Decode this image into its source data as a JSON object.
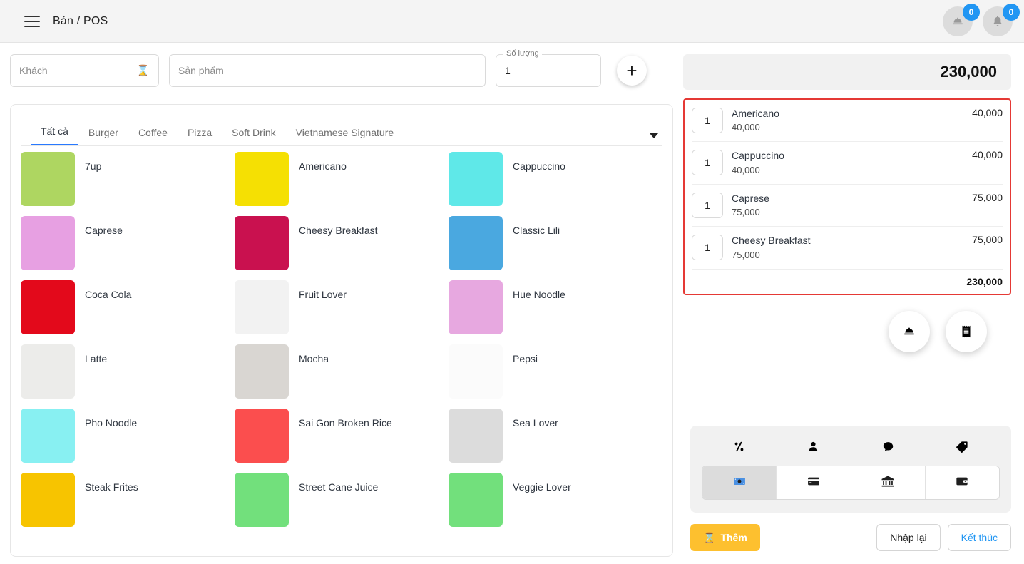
{
  "appbar": {
    "menu_icon": "hamburger-icon",
    "title": "Bán / POS",
    "service_badge": "0",
    "notification_badge": "0"
  },
  "search_row": {
    "customer": {
      "placeholder": "Khách",
      "value": "",
      "trail_icon": "hourglass-icon"
    },
    "product": {
      "placeholder": "Sản phẩm",
      "value": ""
    },
    "quantity": {
      "label": "Số lượng",
      "value": "1"
    },
    "add_button_icon": "plus-icon"
  },
  "tabs": [
    {
      "label": "Tất cả",
      "active": true
    },
    {
      "label": "Burger",
      "active": false
    },
    {
      "label": "Coffee",
      "active": false
    },
    {
      "label": "Pizza",
      "active": false
    },
    {
      "label": "Soft Drink",
      "active": false
    },
    {
      "label": "Vietnamese Signature",
      "active": false
    }
  ],
  "products": [
    {
      "name": "7up",
      "bg": "#aed661"
    },
    {
      "name": "Americano",
      "bg": "#f5e003"
    },
    {
      "name": "Cappuccino",
      "bg": "#5fe8e8"
    },
    {
      "name": "Caprese",
      "bg": "#e7a0e2"
    },
    {
      "name": "Cheesy Breakfast",
      "bg": "#c9114f"
    },
    {
      "name": "Classic Lili",
      "bg": "#4aa8e0"
    },
    {
      "name": "Coca Cola",
      "bg": "#e3091b"
    },
    {
      "name": "Fruit Lover",
      "bg": "#f2f2f2"
    },
    {
      "name": "Hue Noodle",
      "bg": "#e7a8e0"
    },
    {
      "name": "Latte",
      "bg": "#ececea"
    },
    {
      "name": "Mocha",
      "bg": "#d9d6d2"
    },
    {
      "name": "Pepsi",
      "bg": "#fbfbfb"
    },
    {
      "name": "Pho Noodle",
      "bg": "#88f0f2"
    },
    {
      "name": "Sai Gon Broken Rice",
      "bg": "#fb4e4e"
    },
    {
      "name": "Sea Lover",
      "bg": "#dcdcdc"
    },
    {
      "name": "Steak Frites",
      "bg": "#f7c400"
    },
    {
      "name": "Street Cane Juice",
      "bg": "#72e07c"
    },
    {
      "name": "Veggie Lover",
      "bg": "#72e07c"
    }
  ],
  "cart": {
    "header_total": "230,000",
    "items": [
      {
        "qty": "1",
        "name": "Americano",
        "unit_price": "40,000",
        "amount": "40,000"
      },
      {
        "qty": "1",
        "name": "Cappuccino",
        "unit_price": "40,000",
        "amount": "40,000"
      },
      {
        "qty": "1",
        "name": "Caprese",
        "unit_price": "75,000",
        "amount": "75,000"
      },
      {
        "qty": "1",
        "name": "Cheesy Breakfast",
        "unit_price": "75,000",
        "amount": "75,000"
      }
    ],
    "total": "230,000"
  },
  "fabs": [
    {
      "icon": "service-bell-icon"
    },
    {
      "icon": "receipt-icon"
    }
  ],
  "payment": {
    "option_icons": [
      {
        "icon": "percent-icon"
      },
      {
        "icon": "person-icon"
      },
      {
        "icon": "comment-icon"
      },
      {
        "icon": "tag-icon"
      }
    ],
    "methods": [
      {
        "icon": "cash-icon",
        "selected": true
      },
      {
        "icon": "credit-card-icon",
        "selected": false
      },
      {
        "icon": "bank-icon",
        "selected": false
      },
      {
        "icon": "wallet-icon",
        "selected": false
      }
    ]
  },
  "actions": {
    "add_label": "Thêm",
    "add_icon": "hourglass-icon",
    "reset_label": "Nhập lại",
    "finish_label": "Kết thúc"
  },
  "colors": {
    "accent_blue": "#2196f3",
    "cart_border_red": "#e53935",
    "add_yellow": "#fdc02f"
  }
}
